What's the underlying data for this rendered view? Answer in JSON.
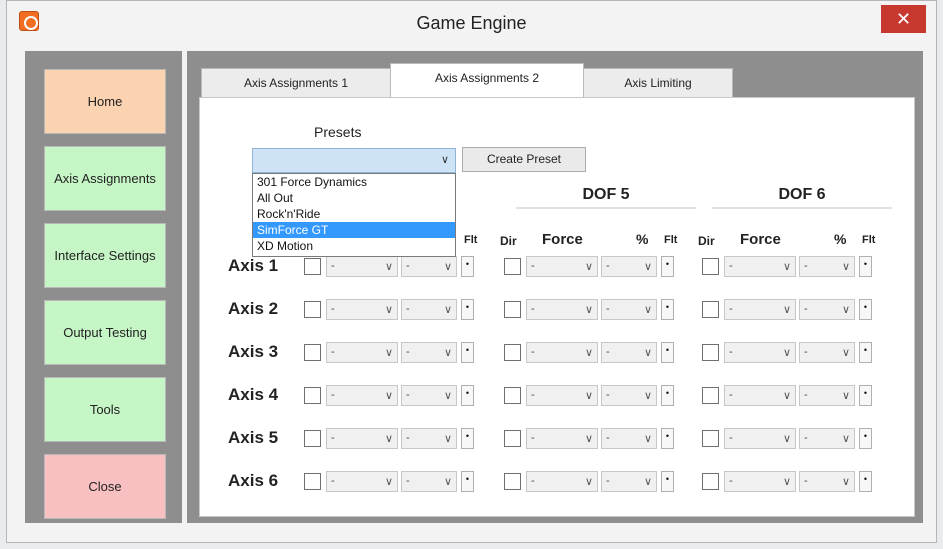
{
  "window": {
    "title": "Game Engine",
    "close_glyph": "✕"
  },
  "sidebar": {
    "items": [
      {
        "label": "Home",
        "color": "#fcd3b0"
      },
      {
        "label": "Axis Assignments",
        "color": "#c6f5c6"
      },
      {
        "label": "Interface Settings",
        "color": "#c6f5c6"
      },
      {
        "label": "Output Testing",
        "color": "#c6f5c6"
      },
      {
        "label": "Tools",
        "color": "#c6f5c6"
      },
      {
        "label": "Close",
        "color": "#f8c0c0"
      }
    ]
  },
  "tabs": [
    {
      "label": "Axis Assignments 1",
      "active": false
    },
    {
      "label": "Axis Assignments 2",
      "active": true
    },
    {
      "label": "Axis Limiting",
      "active": false
    }
  ],
  "presets": {
    "label": "Presets",
    "selected": "",
    "create_button": "Create Preset",
    "options": [
      "301 Force Dynamics",
      "All Out",
      "Rock'n'Ride",
      "SimForce GT",
      "XD Motion"
    ],
    "highlighted_index": 3
  },
  "dof_groups": [
    {
      "title": "DOF 5"
    },
    {
      "title": "DOF 6"
    }
  ],
  "column_headers": {
    "dir": "Dir",
    "force": "Force",
    "percent": "%",
    "flt": "Flt"
  },
  "axes": [
    {
      "label": "Axis 1"
    },
    {
      "label": "Axis 2"
    },
    {
      "label": "Axis 3"
    },
    {
      "label": "Axis 4"
    },
    {
      "label": "Axis 5"
    },
    {
      "label": "Axis 6"
    }
  ],
  "cell": {
    "combo_value": "-",
    "flt_glyph": "•"
  },
  "icons": {
    "dropdown": "chevron-down-icon",
    "app": "app-logo-icon",
    "close": "close-icon"
  }
}
